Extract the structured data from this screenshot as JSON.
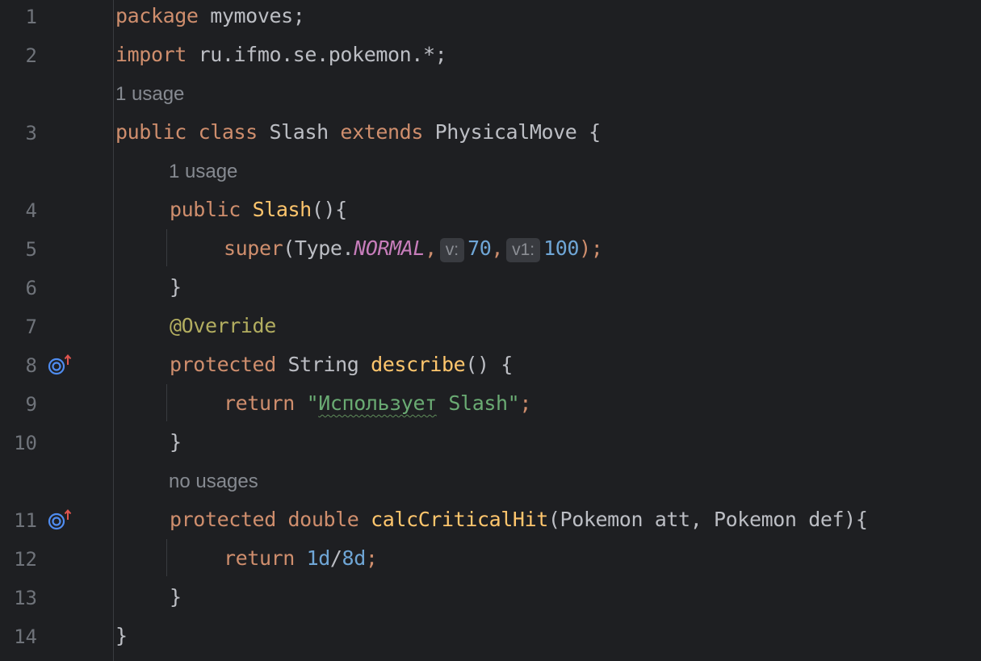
{
  "editor": {
    "line_numbers": [
      "1",
      "2",
      "3",
      "4",
      "5",
      "6",
      "7",
      "8",
      "9",
      "10",
      "11",
      "12",
      "13",
      "14"
    ],
    "usage_hints": {
      "class": "1 usage",
      "constructor": "1 usage",
      "calc": "no usages"
    },
    "code": {
      "l1": {
        "kw": "package",
        "rest": " mymoves;"
      },
      "l2": {
        "kw": "import",
        "rest": " ru.ifmo.se.pokemon.*;"
      },
      "l3": {
        "kw1": "public",
        "kw2": "class",
        "name": "Slash",
        "kw3": "extends",
        "parent": "PhysicalMove",
        "brace": " {"
      },
      "l4": {
        "kw": "public",
        "ctor": "Slash",
        "rest": "(){"
      },
      "l5": {
        "call": "super",
        "open": "(Type.",
        "const": "NORMAL",
        "comma1": ",",
        "hint_v": "v:",
        "num1": "70",
        "comma2": ",",
        "hint_v1": "v1:",
        "num2": "100",
        "close": ");"
      },
      "l6": {
        "text": "}"
      },
      "l7": {
        "ann": "@Override"
      },
      "l8": {
        "kw": "protected",
        "type": "String",
        "method": "describe",
        "rest": "() {"
      },
      "l9": {
        "kw": "return",
        "quote_open": "\"",
        "typo": "Использует",
        "str_rest": " Slash\"",
        "semi": ";"
      },
      "l10": {
        "text": "}"
      },
      "l11": {
        "kw1": "protected",
        "kw2": "double",
        "method": "calcCriticalHit",
        "params": "(Pokemon att, Pokemon def){"
      },
      "l12": {
        "kw": "return",
        "num1": "1d",
        "slash": "/",
        "num2": "8d",
        "semi": ";"
      },
      "l13": {
        "text": "}"
      },
      "l14": {
        "text": "}"
      }
    },
    "gutter_icons": [
      "override-method-icon",
      "override-method-icon"
    ]
  },
  "colors": {
    "background": "#1e1f22",
    "keyword": "#cf8e6d",
    "method": "#56a8f5",
    "declaration": "#ffc66d",
    "number": "#6fa6d6",
    "string": "#6aab73",
    "annotation": "#b3ae60",
    "static_field": "#c77dbb"
  }
}
